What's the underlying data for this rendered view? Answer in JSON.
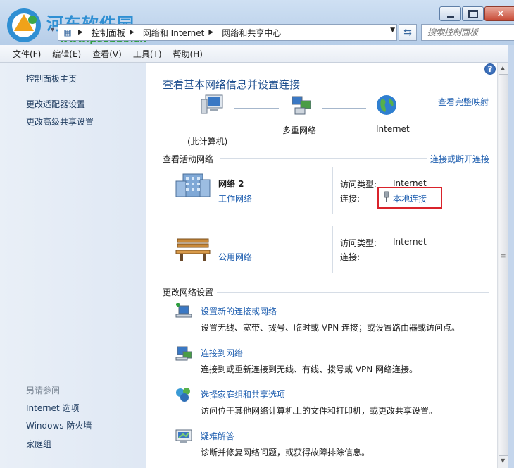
{
  "watermark": {
    "name": "河东软件园",
    "url": "www.pc0359.cn"
  },
  "address": {
    "crumbs": [
      "控制面板",
      "网络和 Internet",
      "网络和共享中心"
    ],
    "search_placeholder": "搜索控制面板"
  },
  "menu": [
    "文件(F)",
    "编辑(E)",
    "查看(V)",
    "工具(T)",
    "帮助(H)"
  ],
  "sidebar": {
    "links": [
      "控制面板主页",
      "更改适配器设置",
      "更改高级共享设置"
    ],
    "see_also_title": "另请参阅",
    "see_also": [
      "Internet 选项",
      "Windows 防火墙",
      "家庭组"
    ]
  },
  "main": {
    "title": "查看基本网络信息并设置连接",
    "view_full_map": "查看完整映射",
    "map": {
      "computer": "(此计算机)",
      "network": "多重网络",
      "internet": "Internet"
    },
    "active_title": "查看活动网络",
    "connect_link": "连接或断开连接",
    "networks": [
      {
        "name": "网络  2",
        "type": "工作网络",
        "access_label": "访问类型:",
        "access": "Internet",
        "conn_label": "连接:",
        "conn": "本地连接"
      },
      {
        "type": "公用网络",
        "access_label": "访问类型:",
        "access": "Internet",
        "conn_label": "连接:"
      }
    ],
    "change_title": "更改网络设置",
    "tasks": [
      {
        "link": "设置新的连接或网络",
        "desc": "设置无线、宽带、拨号、临时或 VPN 连接；或设置路由器或访问点。"
      },
      {
        "link": "连接到网络",
        "desc": "连接到或重新连接到无线、有线、拨号或 VPN 网络连接。"
      },
      {
        "link": "选择家庭组和共享选项",
        "desc": "访问位于其他网络计算机上的文件和打印机，或更改共享设置。"
      },
      {
        "link": "疑难解答",
        "desc": "诊断并修复网络问题，或获得故障排除信息。"
      }
    ]
  }
}
